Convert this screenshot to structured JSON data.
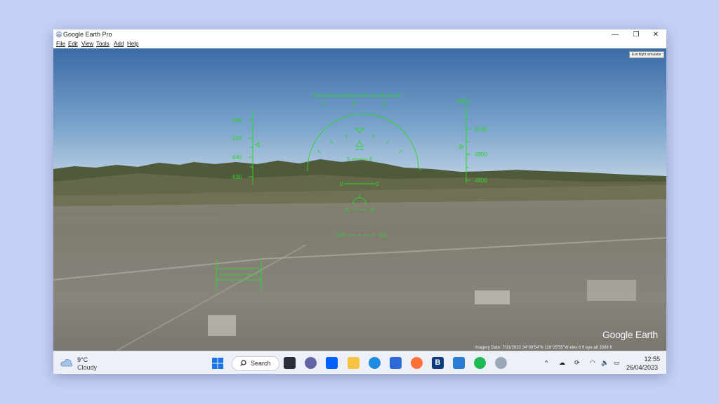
{
  "window": {
    "title": "Google Earth Pro",
    "controls": {
      "minimize": "—",
      "maximize": "❐",
      "close": "✕"
    }
  },
  "menu": [
    "File",
    "Edit",
    "View",
    "Tools",
    "Add",
    "Help"
  ],
  "viewport": {
    "exit_button": "Exit flight simulator",
    "statusbar": "Imagery Date: 7/31/2022   34°09'54\"N 118°25'55\"W  elev 6 ft   eye alt 3506 ft",
    "watermark": "Google Earth",
    "hud": {
      "heading_ticks": [
        "3",
        "6",
        "E"
      ],
      "speed_ticks": [
        "660",
        "650",
        "640",
        "630"
      ],
      "altitude_readout": "3820",
      "altitude_ticks": [
        "5000",
        "4800",
        "4600"
      ],
      "pitch_labels": [
        "5",
        "0",
        "-5",
        "-10"
      ],
      "colors": {
        "hud": "#2bd62b"
      }
    }
  },
  "taskbar": {
    "weather": {
      "temp": "9°C",
      "condition": "Cloudy"
    },
    "search_label": "Search",
    "apps": [
      {
        "name": "task-view",
        "color": "#2a2f3a"
      },
      {
        "name": "teams",
        "color": "#6264a7"
      },
      {
        "name": "dropbox",
        "color": "#0061fe"
      },
      {
        "name": "file-explorer",
        "color": "#f5c242"
      },
      {
        "name": "edge",
        "color": "#1f8be0"
      },
      {
        "name": "store",
        "color": "#2d6ad6"
      },
      {
        "name": "firefox",
        "color": "#ff7139"
      },
      {
        "name": "booking",
        "color": "#0c3b7c"
      },
      {
        "name": "mail",
        "color": "#2b7cd3"
      },
      {
        "name": "spotify",
        "color": "#1db954"
      },
      {
        "name": "google-earth",
        "color": "#9aa7b8"
      }
    ],
    "tray": {
      "chevron": "^",
      "time": "12:55",
      "date": "26/04/2023"
    }
  }
}
